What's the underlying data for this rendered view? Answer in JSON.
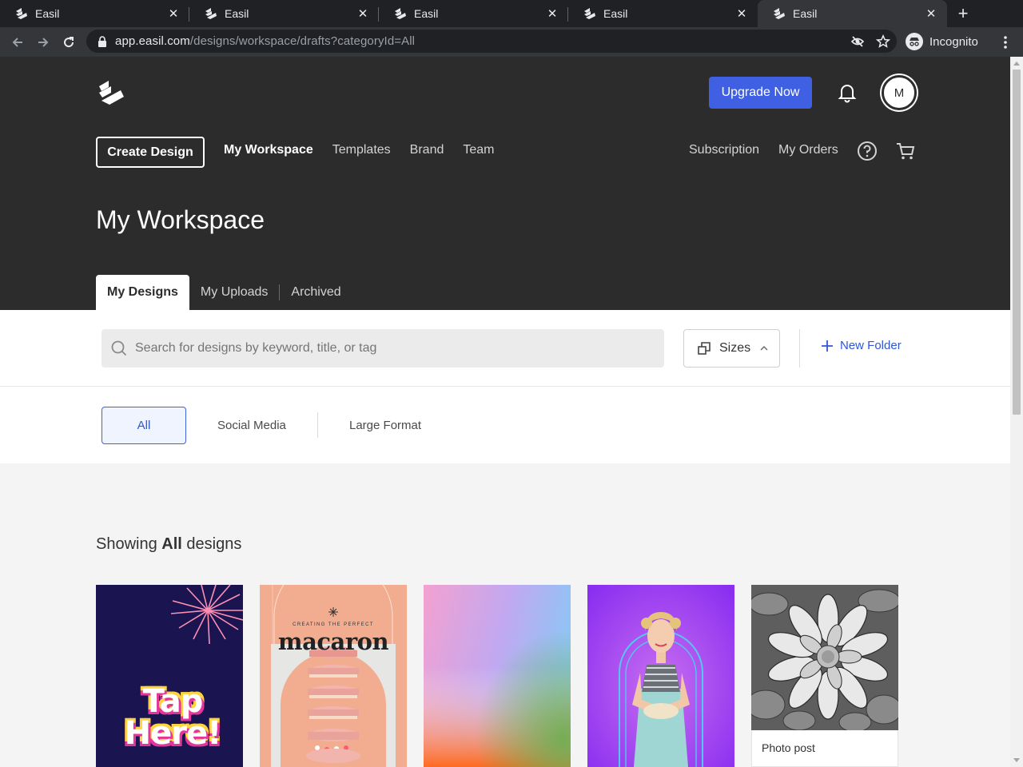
{
  "browser": {
    "tabs": [
      {
        "title": "Easil",
        "active": false
      },
      {
        "title": "Easil",
        "active": false
      },
      {
        "title": "Easil",
        "active": false
      },
      {
        "title": "Easil",
        "active": false
      },
      {
        "title": "Easil",
        "active": true
      }
    ],
    "url_host": "app.easil.com",
    "url_path": "/designs/workspace/drafts?categoryId=All",
    "profile_label": "Incognito"
  },
  "header": {
    "upgrade_label": "Upgrade Now",
    "avatar_initial": "M",
    "create_label": "Create Design",
    "nav": [
      "My Workspace",
      "Templates",
      "Brand",
      "Team"
    ],
    "right_nav": [
      "Subscription",
      "My Orders"
    ],
    "page_title": "My Workspace",
    "sub_tabs": [
      "My Designs",
      "My Uploads",
      "Archived"
    ]
  },
  "search": {
    "placeholder": "Search for designs by keyword, title, or tag",
    "value": "",
    "sizes_label": "Sizes",
    "new_folder_label": "New Folder"
  },
  "filters": {
    "items": [
      "All",
      "Social Media",
      "Large Format"
    ],
    "selected": "All"
  },
  "results": {
    "showing_prefix": "Showing",
    "showing_category": "All",
    "showing_suffix": "designs",
    "cards": [
      {
        "id": "tap-here",
        "text": "Tap Here!"
      },
      {
        "id": "macaron",
        "kicker": "CREATING THE PERFECT",
        "text": "macaron"
      },
      {
        "id": "gradient"
      },
      {
        "id": "retro-woman"
      },
      {
        "id": "photo-post",
        "caption": "Photo post"
      }
    ]
  },
  "colors": {
    "header_bg": "#2c2c2c",
    "accent": "#3f60e2",
    "link": "#2f56d8"
  }
}
